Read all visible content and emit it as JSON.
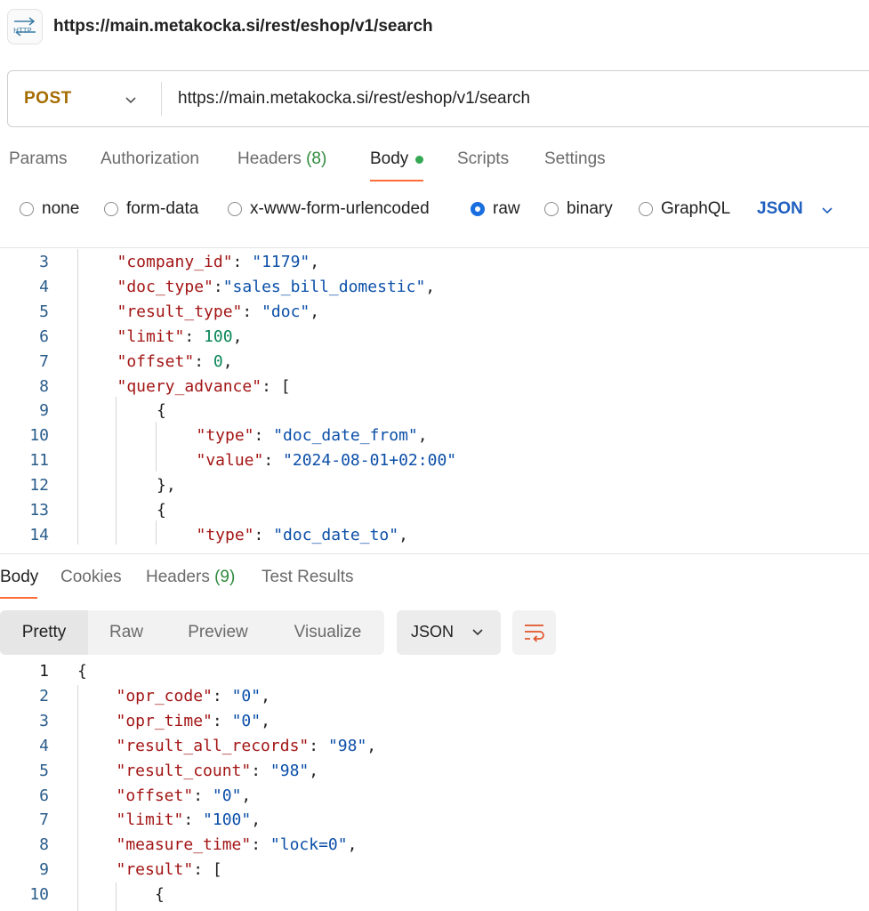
{
  "header": {
    "title": "https://main.metakocka.si/rest/eshop/v1/search",
    "badge": "HTTP"
  },
  "request": {
    "method": "POST",
    "url": "https://main.metakocka.si/rest/eshop/v1/search",
    "tabs": [
      {
        "label": "Params"
      },
      {
        "label": "Authorization"
      },
      {
        "label": "Headers",
        "count": "(8)"
      },
      {
        "label": "Body"
      },
      {
        "label": "Scripts"
      },
      {
        "label": "Settings"
      }
    ],
    "body_types": [
      "none",
      "form-data",
      "x-www-form-urlencoded",
      "raw",
      "binary",
      "GraphQL"
    ],
    "selected_body_type": "raw",
    "language": "JSON",
    "editor_lines": [
      {
        "n": "3",
        "indent": 1,
        "key": "\"company_id\"",
        "sep": ": ",
        "val": "\"1179\"",
        "vtype": "s",
        "tail": ","
      },
      {
        "n": "4",
        "indent": 1,
        "key": "\"doc_type\"",
        "sep": ":",
        "val": "\"sales_bill_domestic\"",
        "vtype": "s",
        "tail": ","
      },
      {
        "n": "5",
        "indent": 1,
        "key": "\"result_type\"",
        "sep": ": ",
        "val": "\"doc\"",
        "vtype": "s",
        "tail": ","
      },
      {
        "n": "6",
        "indent": 1,
        "key": "\"limit\"",
        "sep": ": ",
        "val": "100",
        "vtype": "n",
        "tail": ","
      },
      {
        "n": "7",
        "indent": 1,
        "key": "\"offset\"",
        "sep": ": ",
        "val": "0",
        "vtype": "n",
        "tail": ","
      },
      {
        "n": "8",
        "indent": 1,
        "key": "\"query_advance\"",
        "sep": ": ",
        "val": "",
        "vtype": "s",
        "tail": "["
      },
      {
        "n": "9",
        "indent": 2,
        "key": "",
        "sep": "",
        "val": "",
        "vtype": "s",
        "tail": "{"
      },
      {
        "n": "10",
        "indent": 3,
        "key": "\"type\"",
        "sep": ": ",
        "val": "\"doc_date_from\"",
        "vtype": "s",
        "tail": ","
      },
      {
        "n": "11",
        "indent": 3,
        "key": "\"value\"",
        "sep": ": ",
        "val": "\"2024-08-01+02:00\"",
        "vtype": "s",
        "tail": ""
      },
      {
        "n": "12",
        "indent": 2,
        "key": "",
        "sep": "",
        "val": "",
        "vtype": "s",
        "tail": "},"
      },
      {
        "n": "13",
        "indent": 2,
        "key": "",
        "sep": "",
        "val": "",
        "vtype": "s",
        "tail": "{"
      },
      {
        "n": "14",
        "indent": 3,
        "key": "\"type\"",
        "sep": ": ",
        "val": "\"doc_date_to\"",
        "vtype": "s",
        "tail": ","
      }
    ]
  },
  "response": {
    "tabs": [
      {
        "label": "Body"
      },
      {
        "label": "Cookies"
      },
      {
        "label": "Headers",
        "count": "(9)"
      },
      {
        "label": "Test Results"
      }
    ],
    "views": [
      "Pretty",
      "Raw",
      "Preview",
      "Visualize"
    ],
    "active_view": "Pretty",
    "format": "JSON",
    "body_lines": [
      {
        "n": "1",
        "indent": 0,
        "key": "",
        "sep": "",
        "val": "",
        "vtype": "s",
        "tail": "{"
      },
      {
        "n": "2",
        "indent": 1,
        "key": "\"opr_code\"",
        "sep": ": ",
        "val": "\"0\"",
        "vtype": "s",
        "tail": ","
      },
      {
        "n": "3",
        "indent": 1,
        "key": "\"opr_time\"",
        "sep": ": ",
        "val": "\"0\"",
        "vtype": "s",
        "tail": ","
      },
      {
        "n": "4",
        "indent": 1,
        "key": "\"result_all_records\"",
        "sep": ": ",
        "val": "\"98\"",
        "vtype": "s",
        "tail": ","
      },
      {
        "n": "5",
        "indent": 1,
        "key": "\"result_count\"",
        "sep": ": ",
        "val": "\"98\"",
        "vtype": "s",
        "tail": ","
      },
      {
        "n": "6",
        "indent": 1,
        "key": "\"offset\"",
        "sep": ": ",
        "val": "\"0\"",
        "vtype": "s",
        "tail": ","
      },
      {
        "n": "7",
        "indent": 1,
        "key": "\"limit\"",
        "sep": ": ",
        "val": "\"100\"",
        "vtype": "s",
        "tail": ","
      },
      {
        "n": "8",
        "indent": 1,
        "key": "\"measure_time\"",
        "sep": ": ",
        "val": "\"lock=0\"",
        "vtype": "s",
        "tail": ","
      },
      {
        "n": "9",
        "indent": 1,
        "key": "\"result\"",
        "sep": ": ",
        "val": "",
        "vtype": "s",
        "tail": "["
      },
      {
        "n": "10",
        "indent": 2,
        "key": "",
        "sep": "",
        "val": "",
        "vtype": "s",
        "tail": "{"
      }
    ]
  },
  "colors": {
    "accent": "#ff6c37",
    "method": "#a56c00",
    "radio": "#1a6fe0",
    "json_key": "#a31515",
    "json_string": "#0b4fa8",
    "json_number": "#098658"
  },
  "icons": {
    "badge": "http-icon",
    "chevron": "chevron-down-icon",
    "wrap": "wrap-lines-icon"
  }
}
